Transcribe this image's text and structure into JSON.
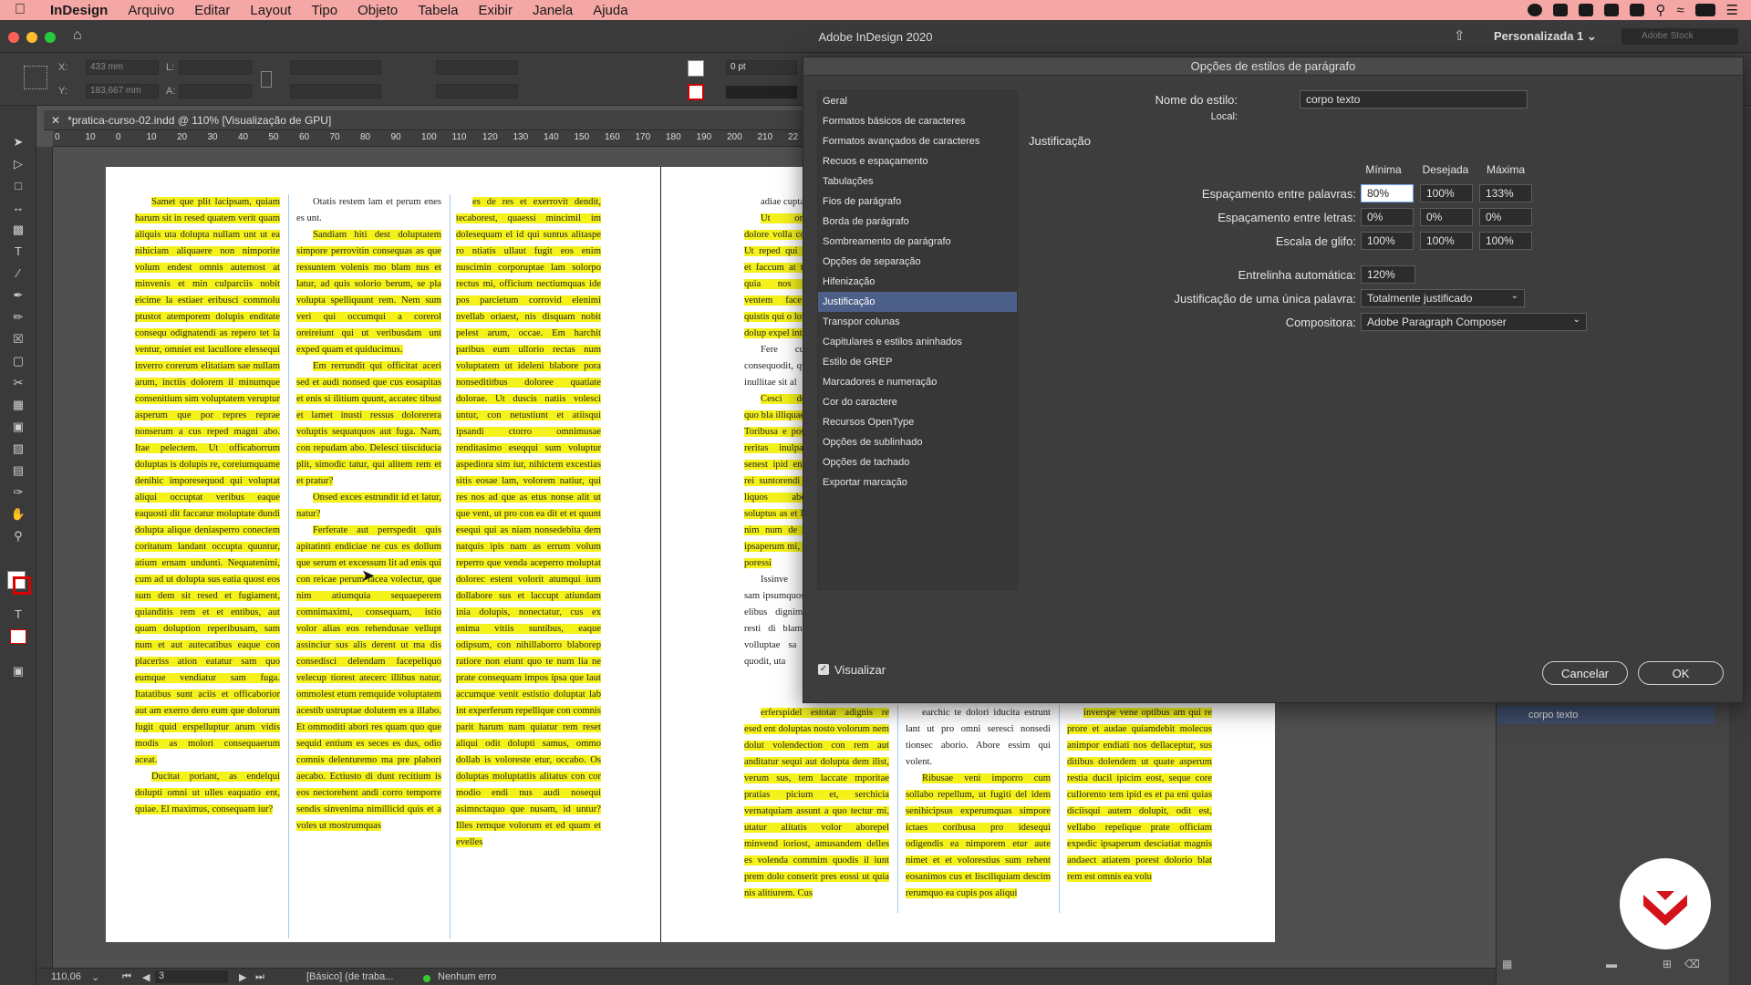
{
  "menubar": {
    "app": "InDesign",
    "items": [
      "Arquivo",
      "Editar",
      "Layout",
      "Tipo",
      "Objeto",
      "Tabela",
      "Exibir",
      "Janela",
      "Ajuda"
    ]
  },
  "window": {
    "title": "Adobe InDesign 2020",
    "workspace": "Personalizada 1",
    "search_placeholder": "Adobe Stock"
  },
  "control": {
    "x_label": "X:",
    "x_value": "433 mm",
    "y_label": "Y:",
    "y_value": "183,667 mm",
    "l_label": "L:",
    "a_label": "A:",
    "stroke_weight": "0 pt"
  },
  "document_tab": "*pratica-curso-02.indd @ 110% [Visualização de GPU]",
  "ruler_ticks": [
    "0",
    "10",
    "0",
    "10",
    "20",
    "30",
    "40",
    "50",
    "60",
    "70",
    "80",
    "90",
    "100",
    "110",
    "120",
    "130",
    "140",
    "150",
    "160",
    "170",
    "180",
    "190",
    "200",
    "210",
    "22"
  ],
  "columns": {
    "left_a": [
      {
        "hl": true,
        "text": "Samet que plit lacipsam, quiam harum sit in resed quatem verit quam aliquis uta dolupta nullam unt ut ea nihiciam aliquaere non nimporite volum endest omnis autemost at minvenis et min culparciis nobit eicime la estiaer eribusci commolu ptustot atemporem dolupis enditate consequ odignatendi as repero tet la ventur, omniet est lacullore elessequi inverro corerum elitatiam sae nullam arum, inctiis dolorem il minumque consenitium sim voluptatem veruptur asperum que por repres repraе nonserum a cus reped magni abo. Itae pelectem. Ut officaborrum doluptas is dolupis re, coreiumquame denihic imporesequod qui voluptat aliqui occuptat veribus eaque eaquosti dit faccatur moluptate dundi dolupta alique deniasperro conectem coritatum landant occupta quuntur, atium ernam undunti. Nequatenimi, cum ad ut dolupta sus eatia quost eos sum dem sit resed et fugiament, quianditis rem et et entibus, aut quam doluption reperibusam, sam num et aut autecatibus eaque con placeriss ation eatatur sam quo eumque vendiatur sam fuga. Itatatibus sunt aciis et officaborior aut am exerro dero eum que dolorum fugit quid erspelluptur arum vidis modis as molori consequaerum aceat."
      },
      {
        "hl": true,
        "text": "Ducitat poriant, as endelqui dolupti omni ut ulles eaquatio ent, quiae. El maximus, consequam iur?"
      }
    ],
    "left_b": [
      {
        "hl": false,
        "text": "Otatis restem lam et perum enes es unt."
      },
      {
        "hl": true,
        "text": "Sandiam hiti dest doluptatem simpore perrovitin consequas as que ressuntem volenis mo blam nus et latur, ad quis solorio berum, se pla volupta spelliquunt rem. Nem sum veri qui occumqui a corerol oreireiunt qui ut veribusdam unt exped quam et quiducimus."
      },
      {
        "hl": true,
        "text": "Em rerrundit qui officitat aceri sed et audi nonsed que cus eosapitas et enis si ilitium quunt, accatec tibust et lamet inusti ressus dolorerera voluptis sequatquos aut fuga. Nam, con repudam abo. Delesci tiisciducia plit, simodic tatur, qui alitem rem et et pratur?"
      },
      {
        "hl": true,
        "text": "Onsed exces estrundit id et latur, natur?"
      },
      {
        "hl": true,
        "text": "Ferferate aut perrspedit quis apitatinti endiciae ne cus es dollum que serum et excessum lit ad enis qui con reicae perum facea volectur, que nim atiumquia sequaeperem comnimaximi, consequam, istio volor alias eos rehendusae vellupt assinciur sus alis derent ut ma dis consedisci delendam facepeliquo velecup tiorest atecerc illibus natur, ommolest etum remquide voluptatem acestib ustruptae dolutem es a illabo. Et ommoditi abori res quam quo que sequid entium es seces es dus, odio comnis delenturemo ma pre plabori aecabo. Ectiusto di dunt recitium is eos nectorehent andi corro temporre sendis sinvenima nimillicid quis et a voles ut mostrumquas"
      }
    ],
    "mid_a": [
      {
        "hl": true,
        "text": "es de res et exerrovit dendit, tecaborest, quaessi mincimil im dolesequam el id qui suntus alitaspe ro ntiatis ullaut fugit eos enim nuscimin corporuptae lam solorpo rectus mi, officium nectiumquas ide pos parcietum corrovid elenimi nvellab oriaest, nis disquam nobit pelest arum, occae. Em harchit paribus eum ullorio rectas num voluptatem ut ideleni blabore pora nonsedititbus doloree quatiate dolorae. Ut duscis natiis volesci untur, con netustiunt et atiisqui ipsandi ctorro omnimusae renditasimo eseqqui sum voluptur aspediora sim iur, nihictem excestias sitis eosae lam, volorem natiur, qui res nos ad que as etus nonse alit ut que vent, ut pro con ea dit et et quunt esequi qui as niam nonsedebita dem natquis ipis nam as errum volum reperro que venda aceperro moluptat dolorec estent volorit atumqui ium dollabore sus et laccupt atiundam inia dolupis, nonectatur, cus ex enima vitiis suntibus, eaque odipsum, con nihillaborro blaborep ratiore non eiunt quo te num lia ne prate consequam impos ipsa que laut accumque venit estistio doluptat lab int experferum repellique con comnis parit harum nam quiatur rem reset aliqui odit dolupti samus, ommo dollab is voloreste etur, occabo. Os doluptas moluptatiis alitatus con cor modio endi nus audi nosequi asimnctaquo que nusam, id untur?Illes remque volorum et ed quam et evelles"
      }
    ],
    "right_a": [
      {
        "hl": false,
        "text": "adiae cuptat."
      },
      {
        "hl": true,
        "text": "Ut omnima dolore volla con tio. Ut reped qui omnis et faccum at tiosant quia nos dave ventem face aut quistis qui o lorem et dolup expel int."
      },
      {
        "hl": false,
        "text": "Fere cumquo consequodit, qua vel inullitae sit al"
      },
      {
        "hl": true,
        "text": "Cesci dolorep quo bla illiquae. Tot? Toribusa e possimin reritas inulpa qui senest ipid enitatem rei suntorendi blabo liquos aborecus soluptus as et la bus, nim num de denda ipsaperum mi, te con poressi"
      },
      {
        "hl": false,
        "text": "Issinve necer sam ipsumquos i eos elibus dignim rum resti di blam tiate volluptae sa quam quodit, uta"
      }
    ],
    "bottom_a": [
      {
        "hl": true,
        "text": "erferspidel estotat adignis re esed ent doluptas nosto volorum nem dolut volendection con rem aut anditatur sequi aut dolupta dem ilist, verum sus, tem laccate mporitae pratias picium et, serchicia vernatquiam assunt a quo tectur mi, utatur alitatis volor aborepel minvend ioriost, amusandem delles es volenda commim quodis il iunt prem dolo conserit pres eossi ut quia nis alitiurem. Cus"
      }
    ],
    "bottom_b": [
      {
        "hl": false,
        "text": "earchic te dolori iducita estrunt lant ut pro omni seresci nonsedi tionsec aborio. Abore essim qui volent."
      },
      {
        "hl": true,
        "text": "Ribusae veni imporro cum sollabo repellum, ut fugiti del idem senihicipsus experumquas simpore ictaes coribusa pro idesequi odigendis ea nimporem etur aute nimet et et volorestius sum rehent eosanimos cus et lisciliquiam descim rerumquo ea cupis pos aliqui"
      }
    ],
    "bottom_c": [
      {
        "hl": true,
        "text": "inverspe vene optibus am qui re prore et audae quiamdebit molecus animpor endiati nos dellaceptur, sus ditibus dolendem ut quate asperum restia ducil ipicim eost, seque core cullorento tem ipid es et pa eni quias diciisqui autem dolupit, odit est, vellabo repelique prate officiam expedic ipsaperum desciatiat magnis andaect atiatem porest dolorio blat rem est omnis ea volu"
      }
    ]
  },
  "dialog": {
    "title": "Opções de estilos de parágrafo",
    "categories": [
      "Geral",
      "Formatos básicos de caracteres",
      "Formatos avançados de caracteres",
      "Recuos e espaçamento",
      "Tabulações",
      "Fios de parágrafo",
      "Borda de parágrafo",
      "Sombreamento de parágrafo",
      "Opções de separação",
      "Hifenização",
      "Justificação",
      "Transpor colunas",
      "Capitulares e estilos aninhados",
      "Estilo de GREP",
      "Marcadores e numeração",
      "Cor do caractere",
      "Recursos OpenType",
      "Opções de sublinhado",
      "Opções de tachado",
      "Exportar marcação"
    ],
    "selected_index": 10,
    "style_name_label": "Nome do estilo:",
    "style_name_value": "corpo texto",
    "local_label": "Local:",
    "section_title": "Justificação",
    "col_headers": [
      "Mínima",
      "Desejada",
      "Máxima"
    ],
    "rows": [
      {
        "label": "Espaçamento entre palavras:",
        "values": [
          "80%",
          "100%",
          "133%"
        ]
      },
      {
        "label": "Espaçamento entre letras:",
        "values": [
          "0%",
          "0%",
          "0%"
        ]
      },
      {
        "label": "Escala de glifo:",
        "values": [
          "100%",
          "100%",
          "100%"
        ]
      }
    ],
    "auto_leading_label": "Entrelinha automática:",
    "auto_leading_value": "120%",
    "single_word_label": "Justificação de uma única palavra:",
    "single_word_value": "Totalmente justificado",
    "composer_label": "Compositora:",
    "composer_value": "Adobe Paragraph Composer",
    "preview_label": "Visualizar",
    "preview_checked": true,
    "cancel_label": "Cancelar",
    "ok_label": "OK"
  },
  "styles_panel": {
    "selected_style": "corpo texto"
  },
  "status": {
    "zoom": "110,06",
    "page": "3",
    "profile": "[Básico] (de traba...",
    "errors": "Nenhum erro"
  },
  "colors": {
    "highlight": "#f5f21b",
    "selection": "#4c5f88",
    "menubar": "#f4a7a5",
    "logo_red": "#d3121a"
  }
}
